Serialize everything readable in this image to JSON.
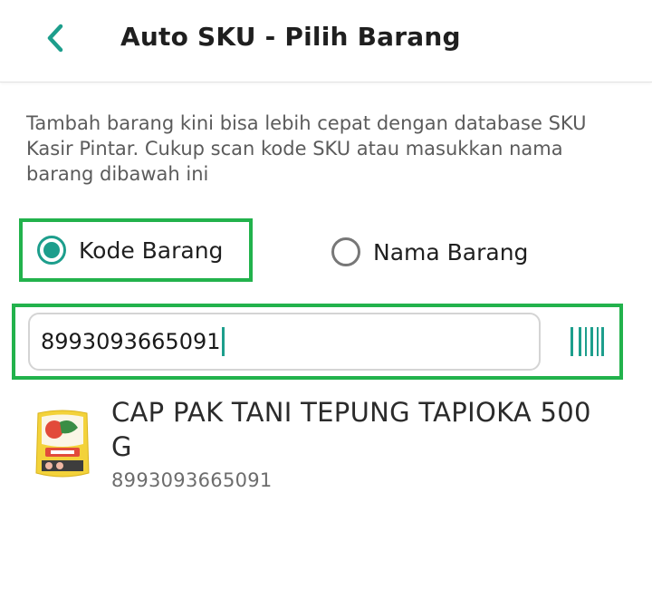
{
  "header": {
    "title": "Auto SKU - Pilih Barang",
    "back_icon": "chevron-left-icon"
  },
  "description": "Tambah barang kini bisa lebih cepat dengan database SKU Kasir Pintar. Cukup scan kode SKU atau masukkan nama barang dibawah ini",
  "search_mode": {
    "options": [
      {
        "label": "Kode Barang",
        "selected": true
      },
      {
        "label": "Nama Barang",
        "selected": false
      }
    ]
  },
  "search": {
    "value": "8993093665091",
    "scan_icon": "barcode-icon"
  },
  "results": [
    {
      "name": "CAP PAK TANI TEPUNG TAPIOKA 500 G",
      "code": "8993093665091",
      "image": "product-thumbnail"
    }
  ],
  "colors": {
    "accent": "#1d9e8c",
    "highlight_border": "#22b24c",
    "text_primary": "#1f1f1f",
    "text_secondary": "#5b5b5b"
  }
}
